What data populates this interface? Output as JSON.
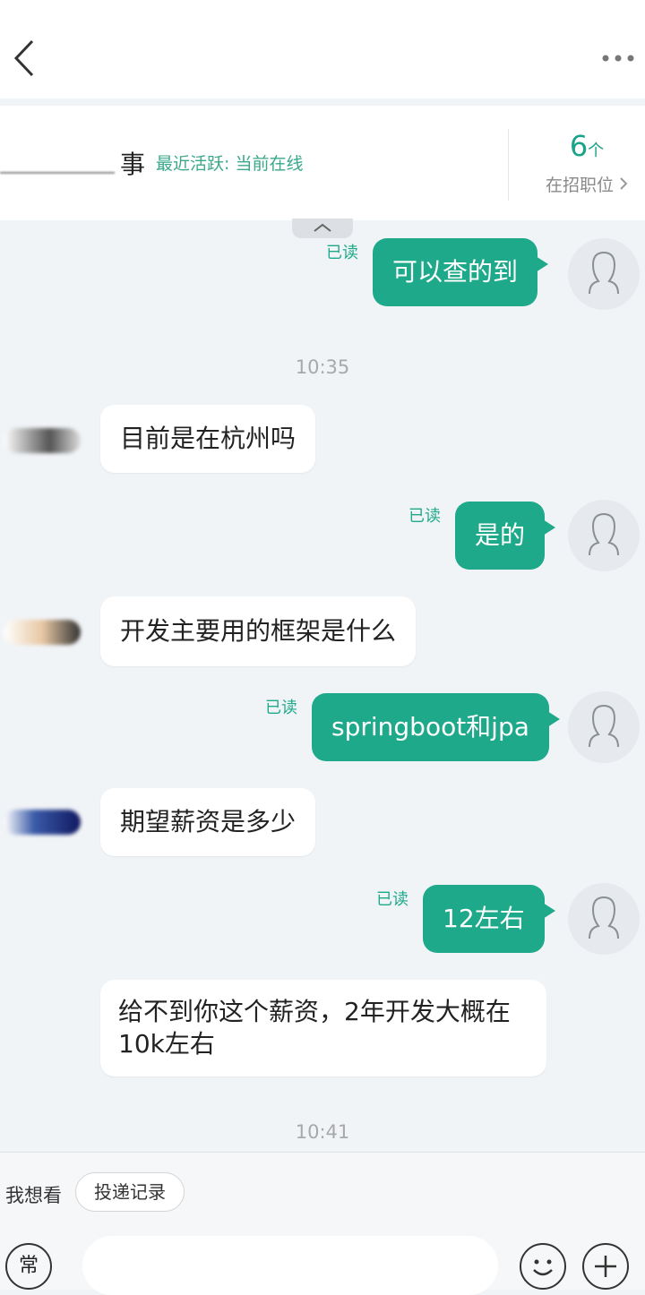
{
  "contact": {
    "name_suffix": "事",
    "status": "最近活跃: 当前在线",
    "job_count": "6",
    "job_count_unit": "个",
    "job_label": "在招职位"
  },
  "messages": [
    {
      "dir": "out",
      "text": "可以查的到",
      "read": "已读"
    },
    {
      "dir": "time",
      "text": "10:35"
    },
    {
      "dir": "in",
      "text": "目前是在杭州吗"
    },
    {
      "dir": "out",
      "text": "是的",
      "read": "已读"
    },
    {
      "dir": "in",
      "text": "开发主要用的框架是什么"
    },
    {
      "dir": "out",
      "text": "springboot和jpa",
      "read": "已读"
    },
    {
      "dir": "in",
      "text": "期望薪资是多少"
    },
    {
      "dir": "out",
      "text": "12左右",
      "read": "已读"
    },
    {
      "dir": "in",
      "text": "给不到你这个薪资，2年开发大概在10k左右"
    },
    {
      "dir": "time",
      "text": "10:41"
    }
  ],
  "bottom": {
    "quick_label": "我想看",
    "quick_chip": "投递记录",
    "common_btn": "常",
    "input_placeholder": ""
  },
  "icons": {
    "back": "chevron-left-icon",
    "more": "more-dots-icon",
    "collapse": "chevron-up-icon",
    "emoji": "emoji-icon",
    "plus": "plus-icon"
  },
  "colors": {
    "accent": "#1fa98b",
    "background": "#f1f4f7"
  }
}
